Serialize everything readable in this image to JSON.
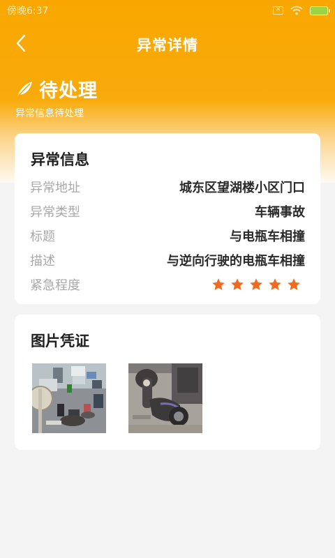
{
  "status_bar": {
    "time": "傍晚6:37"
  },
  "nav": {
    "title": "异常详情"
  },
  "status": {
    "title": "待处理",
    "subtitle": "异常信息待处理"
  },
  "info_card": {
    "title": "异常信息",
    "rows": [
      {
        "label": "异常地址",
        "value": "城东区望湖楼小区门口"
      },
      {
        "label": "异常类型",
        "value": "车辆事故"
      },
      {
        "label": "标题",
        "value": "与电瓶车相撞"
      },
      {
        "label": "描述",
        "value": "与逆向行驶的电瓶车相撞"
      }
    ],
    "urgency": {
      "label": "紧急程度",
      "stars": 5,
      "max": 5
    }
  },
  "photos_card": {
    "title": "图片凭证",
    "photos": [
      "photo-accident-street",
      "photo-damaged-scooter"
    ]
  },
  "colors": {
    "accent": "#f9a700",
    "star": "#f26b1d"
  }
}
